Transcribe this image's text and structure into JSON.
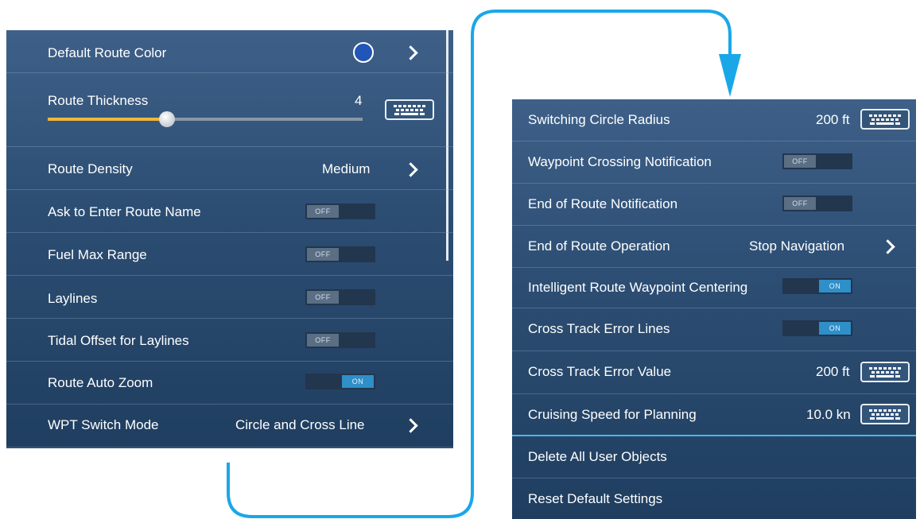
{
  "colors": {
    "panel": "#2c4d72",
    "route_color": "#2255b8",
    "connector": "#1aa7e8",
    "slider_fill": "#f0b73a",
    "toggle_on": "#2f8fc8"
  },
  "left": {
    "default_route_color": {
      "label": "Default Route Color",
      "icon": "chevron-right-icon"
    },
    "route_thickness": {
      "label": "Route Thickness",
      "value": "4",
      "slider_fraction": 0.38,
      "icon": "keyboard-icon"
    },
    "route_density": {
      "label": "Route Density",
      "value": "Medium",
      "icon": "chevron-right-icon"
    },
    "ask_route_name": {
      "label": "Ask to Enter Route Name",
      "state": "OFF"
    },
    "fuel_max_range": {
      "label": "Fuel Max Range",
      "state": "OFF"
    },
    "laylines": {
      "label": "Laylines",
      "state": "OFF"
    },
    "tidal_offset": {
      "label": "Tidal Offset for Laylines",
      "state": "OFF"
    },
    "route_auto_zoom": {
      "label": "Route Auto Zoom",
      "state": "ON"
    },
    "wpt_switch_mode": {
      "label": "WPT Switch Mode",
      "value": "Circle and Cross Line",
      "icon": "chevron-right-icon"
    }
  },
  "right": {
    "switching_circle_radius": {
      "label": "Switching Circle Radius",
      "value": "200 ft",
      "icon": "keyboard-icon"
    },
    "waypoint_crossing": {
      "label": "Waypoint Crossing Notification",
      "state": "OFF"
    },
    "end_route_notification": {
      "label": "End of Route Notification",
      "state": "OFF"
    },
    "end_route_operation": {
      "label": "End of Route Operation",
      "value": "Stop Navigation",
      "icon": "chevron-right-icon"
    },
    "intelligent_centering": {
      "label": "Intelligent Route Waypoint Centering",
      "state": "ON"
    },
    "cross_track_lines": {
      "label": "Cross Track Error Lines",
      "state": "ON"
    },
    "cross_track_value": {
      "label": "Cross Track Error Value",
      "value": "200 ft",
      "icon": "keyboard-icon"
    },
    "cruising_speed": {
      "label": "Cruising Speed for Planning",
      "value": "10.0 kn",
      "icon": "keyboard-icon"
    },
    "delete_all": {
      "label": "Delete All User Objects"
    },
    "reset_defaults": {
      "label": "Reset Default Settings"
    }
  }
}
